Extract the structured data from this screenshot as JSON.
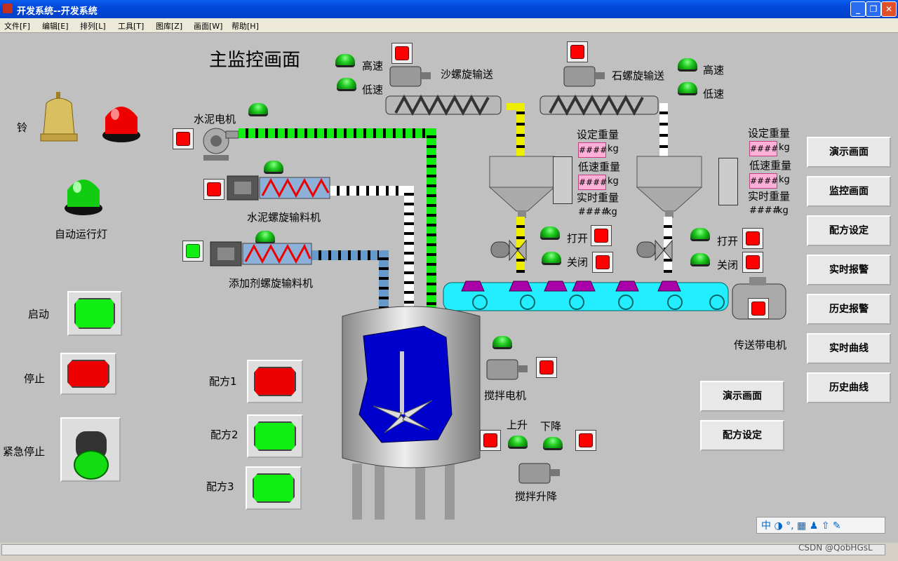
{
  "window": {
    "title": "开发系统--开发系统",
    "buttons": [
      "_",
      "❐",
      "✕"
    ]
  },
  "menu": [
    "文件[F]",
    "编辑[E]",
    "排列[L]",
    "工具[T]",
    "图库[Z]",
    "画面[W]",
    "帮助[H]"
  ],
  "screen_title": "主监控画面",
  "labels": {
    "bell": "铃",
    "pump": "水泥电机",
    "cement": "水泥螺旋输料机",
    "additive": "添加剂螺旋输料机",
    "auto_light": "自动运行灯",
    "start": "启动",
    "stop": "停止",
    "estop": "紧急停止",
    "r1": "配方1",
    "r2": "配方2",
    "r3": "配方3",
    "sand": "沙螺旋输送",
    "stone": "石螺旋输送",
    "high1": "高速",
    "low1": "低速",
    "high2": "高速",
    "low2": "低速",
    "set_w1": "设定重量",
    "low_w1": "低速重量",
    "real_w1": "实时重量",
    "set_w2": "设定重量",
    "low_w2": "低速重量",
    "real_w2": "实时重量",
    "open1": "打开",
    "close1": "关闭",
    "open2": "打开",
    "close2": "关闭",
    "belt_motor": "传送带电机",
    "mixer": "搅拌电机",
    "up": "上升",
    "down": "下降",
    "lift": "搅拌升降",
    "kg": "kg",
    "hash": "####"
  },
  "nav": [
    "演示画面",
    "监控画面",
    "配方设定",
    "实时报警",
    "历史报警",
    "实时曲线",
    "历史曲线"
  ],
  "nav2": [
    "演示画面",
    "配方设定"
  ],
  "ime": "中 ◑ °, ▦ ♟ ⇧ ✎",
  "watermark": "CSDN @QobHGsL"
}
